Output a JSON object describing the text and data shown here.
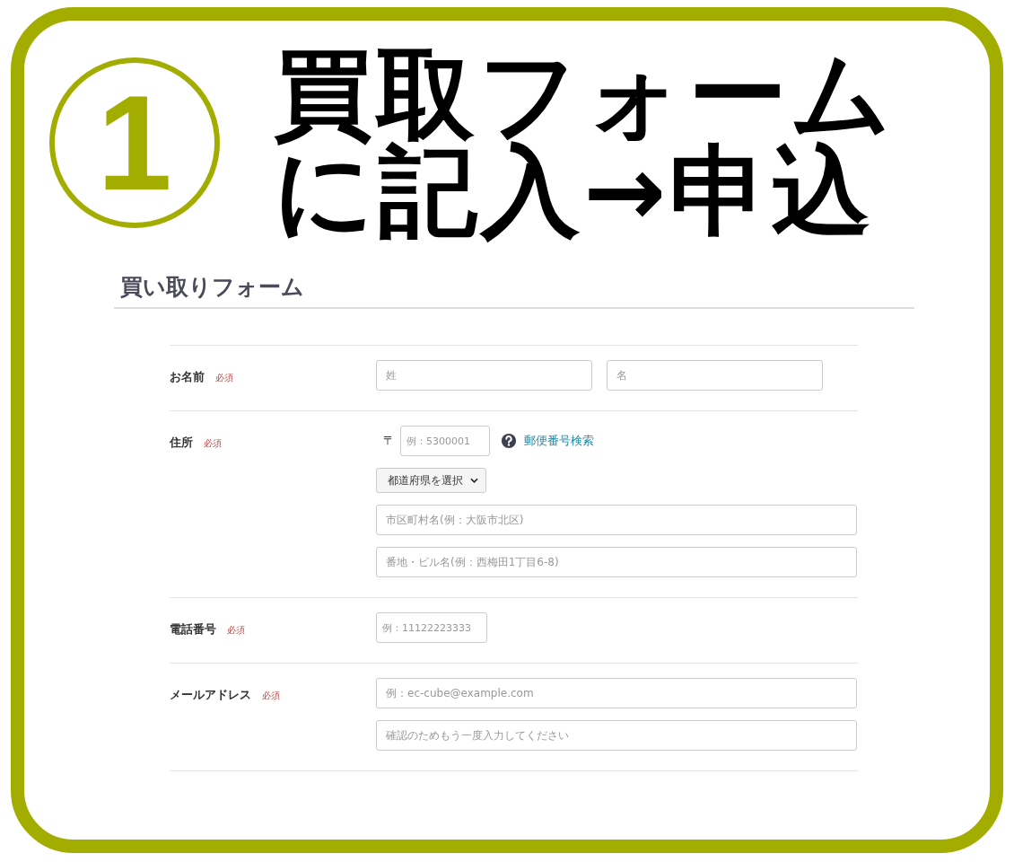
{
  "step_number": "1",
  "headline": [
    "買取フォーム",
    "に記入→申込"
  ],
  "form": {
    "title": "買い取りフォーム",
    "rows": [
      {
        "kind": "name",
        "label": "お名前",
        "required": "必須",
        "fields": [
          {
            "placeholder": "姓"
          },
          {
            "placeholder": "名"
          }
        ]
      },
      {
        "kind": "address",
        "label": "住所",
        "required": "必須",
        "postal_mark": "〒",
        "postal_field": {
          "placeholder": "例：5300001"
        },
        "help_link": "郵便番号検索",
        "prefecture_select": "都道府県を選択",
        "fields": [
          {
            "placeholder": "市区町村名(例：大阪市北区)"
          },
          {
            "placeholder": "番地・ビル名(例：西梅田1丁目6-8)"
          }
        ]
      },
      {
        "kind": "phone",
        "label": "電話番号",
        "required": "必須",
        "fields": [
          {
            "placeholder": "例：11122223333"
          }
        ]
      },
      {
        "kind": "email",
        "label": "メールアドレス",
        "required": "必須",
        "fields": [
          {
            "placeholder": "例：ec-cube@example.com"
          },
          {
            "placeholder": "確認のためもう一度入力してください"
          }
        ]
      }
    ]
  }
}
